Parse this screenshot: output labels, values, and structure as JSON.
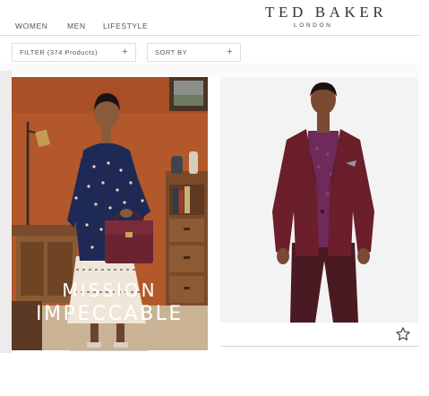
{
  "nav": {
    "women": "WOMEN",
    "men": "MEN",
    "lifestyle": "LIFESTYLE"
  },
  "brand": {
    "name": "TED BAKER",
    "sub": "LONDON"
  },
  "toolbar": {
    "filter_label": "FILTER (374 Products)",
    "sort_label": "SORT BY",
    "plus_glyph": "+"
  },
  "campaign": {
    "line1": "MISSION",
    "line2": "IMPECCABLE"
  },
  "colors": {
    "background": "#ffffff",
    "campaign_wall": "#b2582b",
    "jacket": "#6b1f2a"
  },
  "icons": {
    "favorite": "star-outline-icon"
  }
}
